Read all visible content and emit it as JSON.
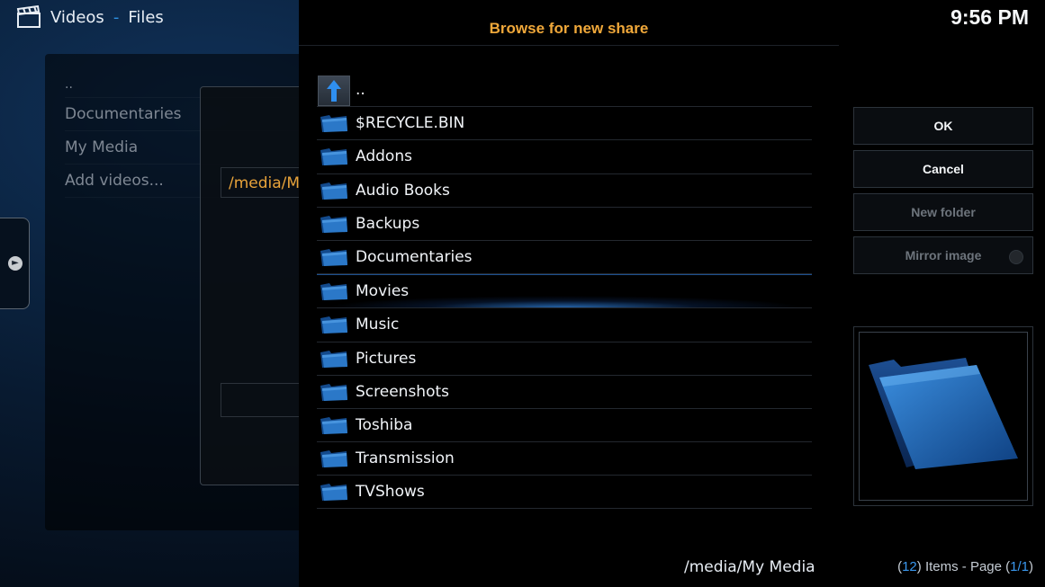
{
  "header": {
    "section": "Videos",
    "separator": "-",
    "subsection": "Files"
  },
  "clock": "9:56 PM",
  "left_list": {
    "parent": "..",
    "items": [
      "Documentaries",
      "My Media",
      "Add videos..."
    ]
  },
  "add_dialog": {
    "path_value": "/media/My"
  },
  "modal": {
    "title": "Browse for new share",
    "parent_entry": "..",
    "folders": [
      "$RECYCLE.BIN",
      "Addons",
      "Audio Books",
      "Backups",
      "Documentaries",
      "Movies",
      "Music",
      "Pictures",
      "Screenshots",
      "Toshiba",
      "Transmission",
      "TVShows"
    ],
    "focused_folder": "Movies",
    "current_path": "/media/My Media"
  },
  "buttons": {
    "ok": "OK",
    "cancel": "Cancel",
    "new_folder": "New folder",
    "mirror_image": "Mirror image"
  },
  "status": {
    "items_open": "(",
    "items_count": "12",
    "items_mid": ") Items - Page (",
    "page": "1/1",
    "items_close": ")"
  },
  "colors": {
    "accent_orange": "#f0a83a",
    "accent_blue": "#3a98ef",
    "focus_glow": "#3796ff"
  },
  "icons": {
    "folder": "folder-icon",
    "parent": "arrow-up-icon",
    "clapperboard": "clapperboard-icon"
  }
}
